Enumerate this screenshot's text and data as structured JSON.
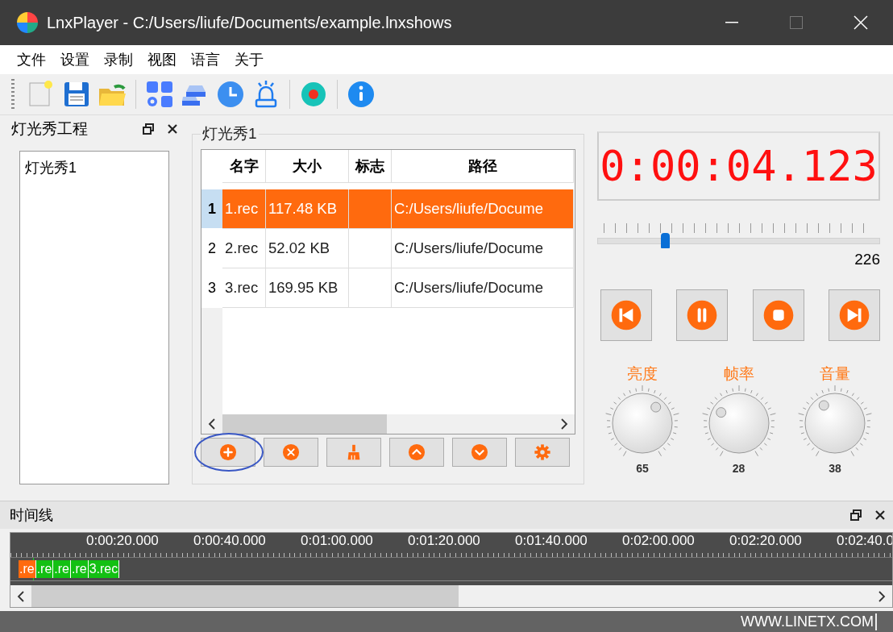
{
  "window": {
    "title": "LnxPlayer - C:/Users/liufe/Documents/example.lnxshows"
  },
  "menu": [
    "文件",
    "设置",
    "录制",
    "视图",
    "语言",
    "关于"
  ],
  "project_panel": {
    "title": "灯光秀工程",
    "items": [
      {
        "label": "灯光秀1",
        "selected": false
      }
    ]
  },
  "show_group": {
    "title": "灯光秀1",
    "table": {
      "columns": [
        "名字",
        "大小",
        "标志",
        "路径"
      ],
      "rows": [
        {
          "index": "1",
          "cells": [
            "1.rec",
            "117.48 KB",
            "",
            "C:/Users/liufe/Docume"
          ],
          "selected": true
        },
        {
          "index": "2",
          "cells": [
            "2.rec",
            "52.02 KB",
            "",
            "C:/Users/liufe/Docume"
          ],
          "selected": false
        },
        {
          "index": "3",
          "cells": [
            "3.rec",
            "169.95 KB",
            "",
            "C:/Users/liufe/Docume"
          ],
          "selected": false
        }
      ]
    }
  },
  "player": {
    "time": "0:00:04.123",
    "position": {
      "level": 0.24,
      "reading": "226"
    },
    "knobs": [
      {
        "label": "亮度",
        "reading": "65"
      },
      {
        "label": "帧率",
        "reading": "28"
      },
      {
        "label": "音量",
        "reading": "38"
      }
    ]
  },
  "timeline": {
    "title": "时间线",
    "ticks": [
      "0:00:20.000",
      "0:00:40.000",
      "0:01:00.000",
      "0:01:20.000",
      "0:01:40.000",
      "0:02:00.000",
      "0:02:20.000",
      "0:02:40.0"
    ],
    "clips": [
      {
        "label": ".re",
        "selected": true
      },
      {
        "label": ".re",
        "selected": false
      },
      {
        "label": ".re",
        "selected": false
      },
      {
        "label": ".re",
        "selected": false
      },
      {
        "label": "3.rec",
        "selected": false
      }
    ]
  },
  "status_bar": {
    "text": "WWW.LINETX.COM"
  }
}
